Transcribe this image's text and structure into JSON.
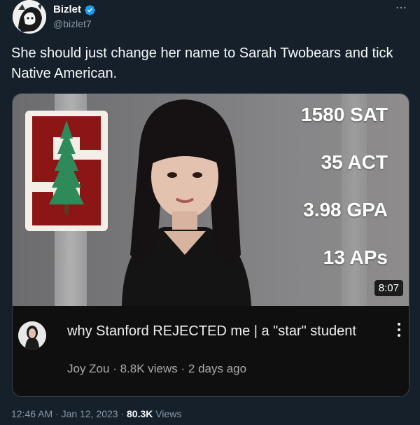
{
  "tweet": {
    "author": {
      "display_name": "Bizlet",
      "handle": "@bizlet7",
      "verified": true
    },
    "text": "She should just change her name to Sarah Twobears and tick Native American.",
    "timestamp": "12:46 AM · Jan 12, 2023 · ",
    "views_count": "80.3K",
    "views_label": " Views"
  },
  "video": {
    "stats": [
      "1580 SAT",
      "35 ACT",
      "3.98 GPA",
      "13 APs"
    ],
    "duration": "8:07",
    "title": "why Stanford REJECTED me | a \"star\" student",
    "channel": "Joy Zou",
    "meta": "Joy Zou · 8.8K views · 2 days ago"
  },
  "colors": {
    "background": "#15202b",
    "verified_blue": "#1d9bf0",
    "stanford_red": "#8c1515",
    "tree_green": "#2f8a5a",
    "secondary_text": "#8b98a5"
  },
  "icons": {
    "verified": "verified-badge-icon",
    "more": "more-horizontal-icon",
    "video_more": "more-vertical-icon"
  }
}
